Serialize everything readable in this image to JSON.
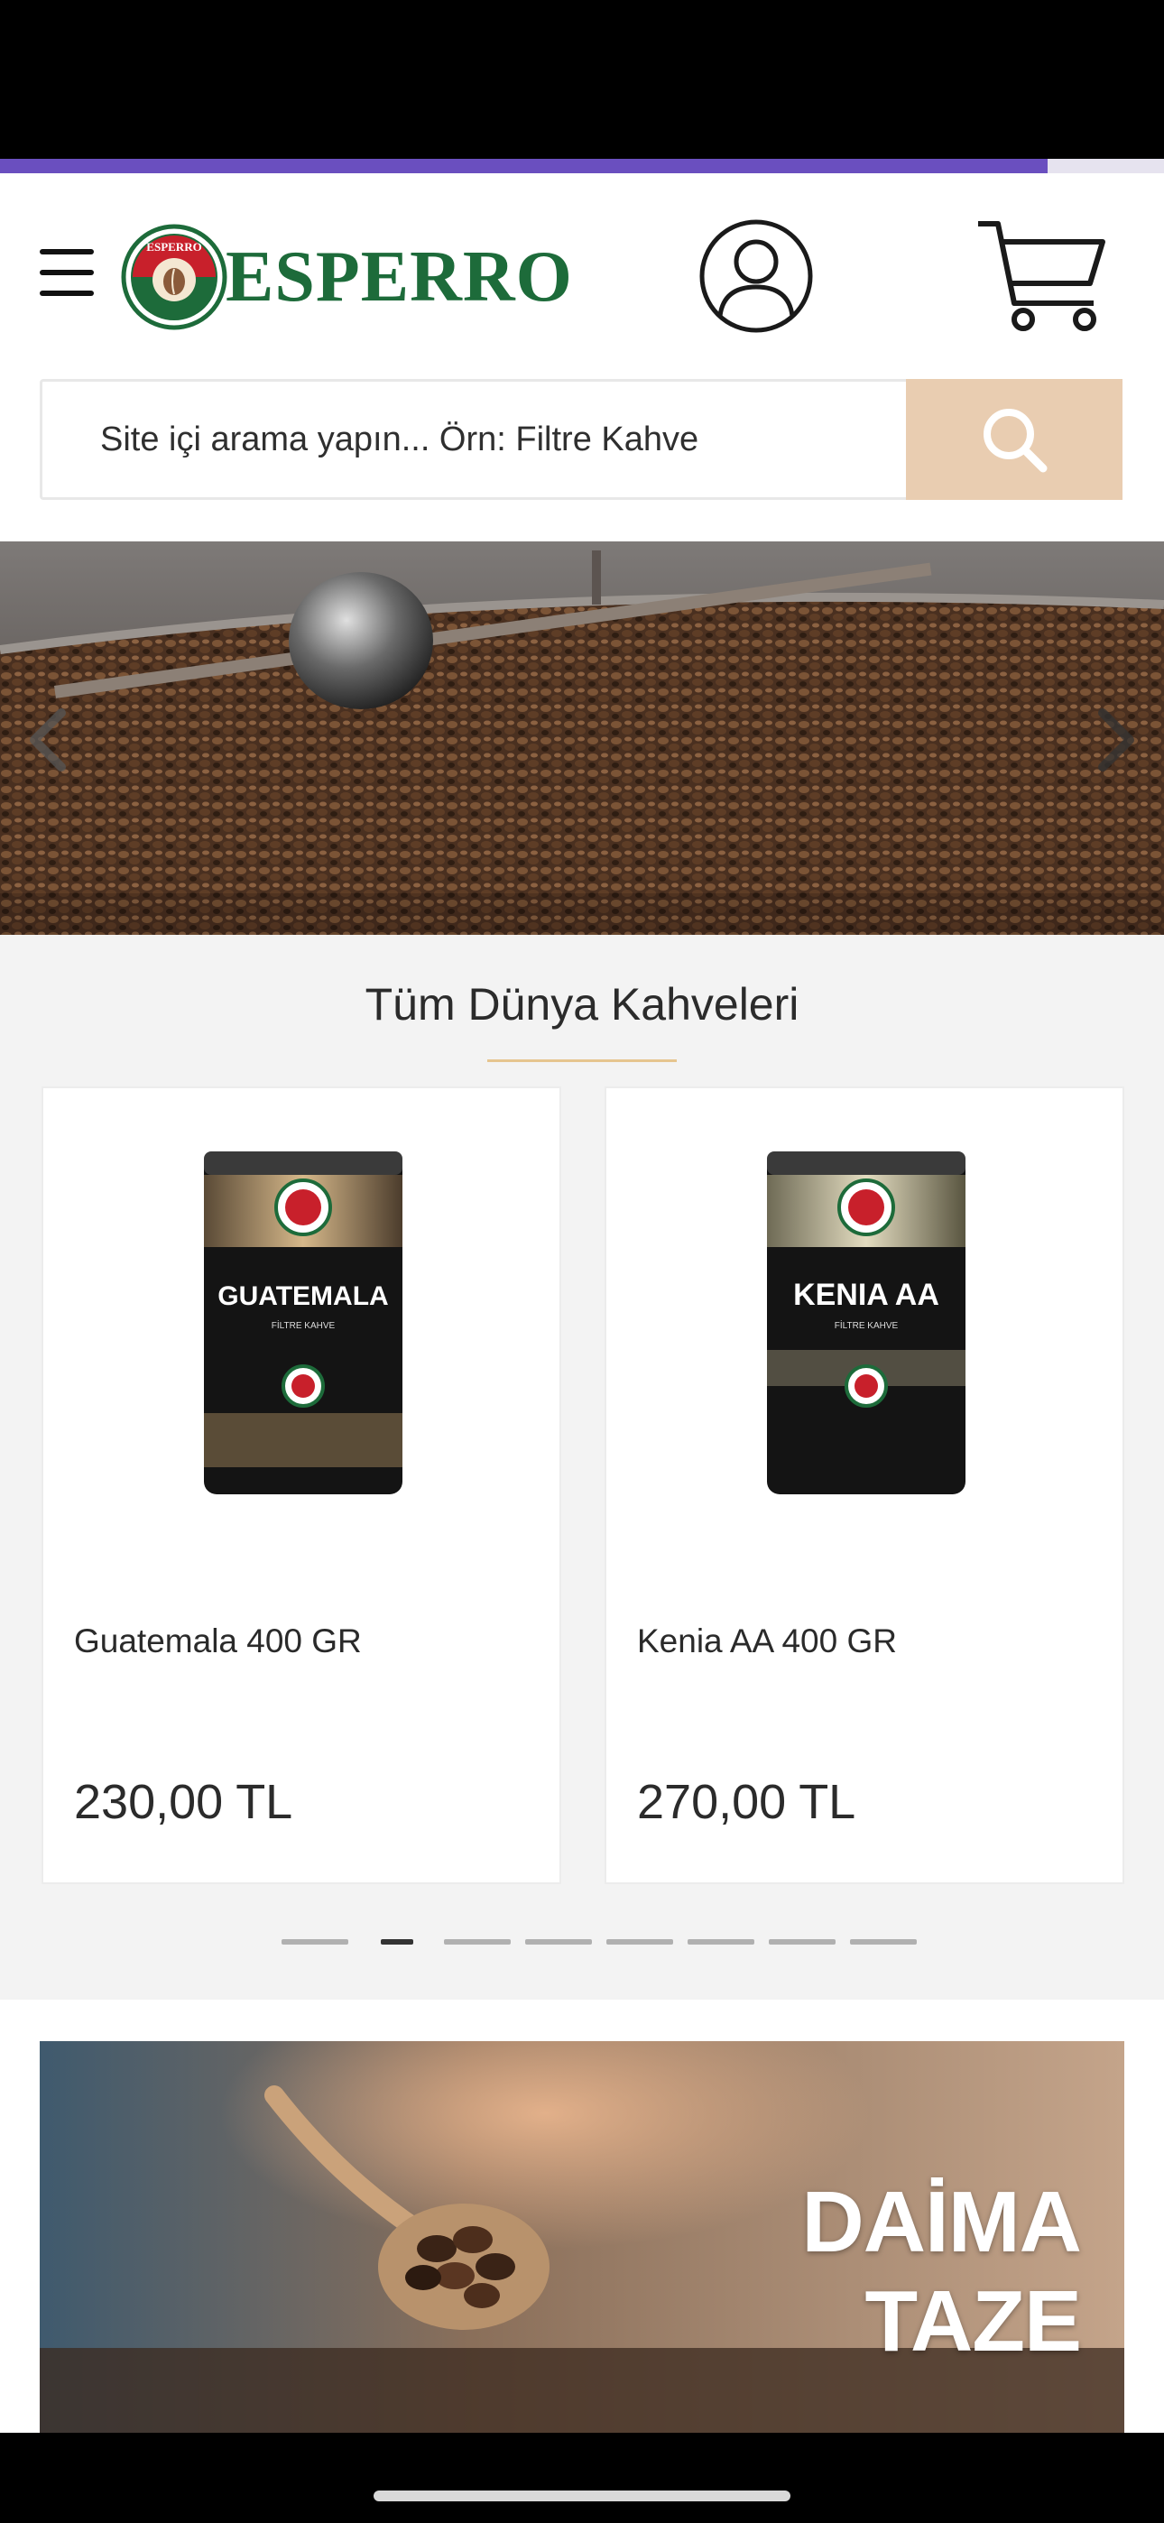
{
  "status_bar": {},
  "page_load_progress": 0.9,
  "header": {
    "logo_text": "ESPERRO",
    "logo_badge_text": "ESPERRO"
  },
  "search": {
    "placeholder": "Site içi arama yapın... Örn: Filtre Kahve"
  },
  "hero": {
    "prev_icon": "chevron-left-icon",
    "next_icon": "chevron-right-icon"
  },
  "section": {
    "title": "Tüm Dünya Kahveleri"
  },
  "products": [
    {
      "name": "Guatemala 400 GR",
      "price": "230,00 TL",
      "can_label": "GUATEMALA",
      "can_sub": "FİLTRE KAHVE",
      "can_brand": "ESPERRO"
    },
    {
      "name": "Kenia AA 400 GR",
      "price": "270,00 TL",
      "can_label": "KENIA AA",
      "can_sub": "FİLTRE KAHVE",
      "can_brand": "ESPERRO"
    }
  ],
  "carousel": {
    "count": 8,
    "active": 1
  },
  "promo_banner": {
    "line1": "DAİMA",
    "line2": "TAZE"
  },
  "colors": {
    "brand_green": "#1d6b3a",
    "progress": "#6a4fbf",
    "search_button": "#e9cdb1",
    "title_underline": "#e6c58f"
  }
}
